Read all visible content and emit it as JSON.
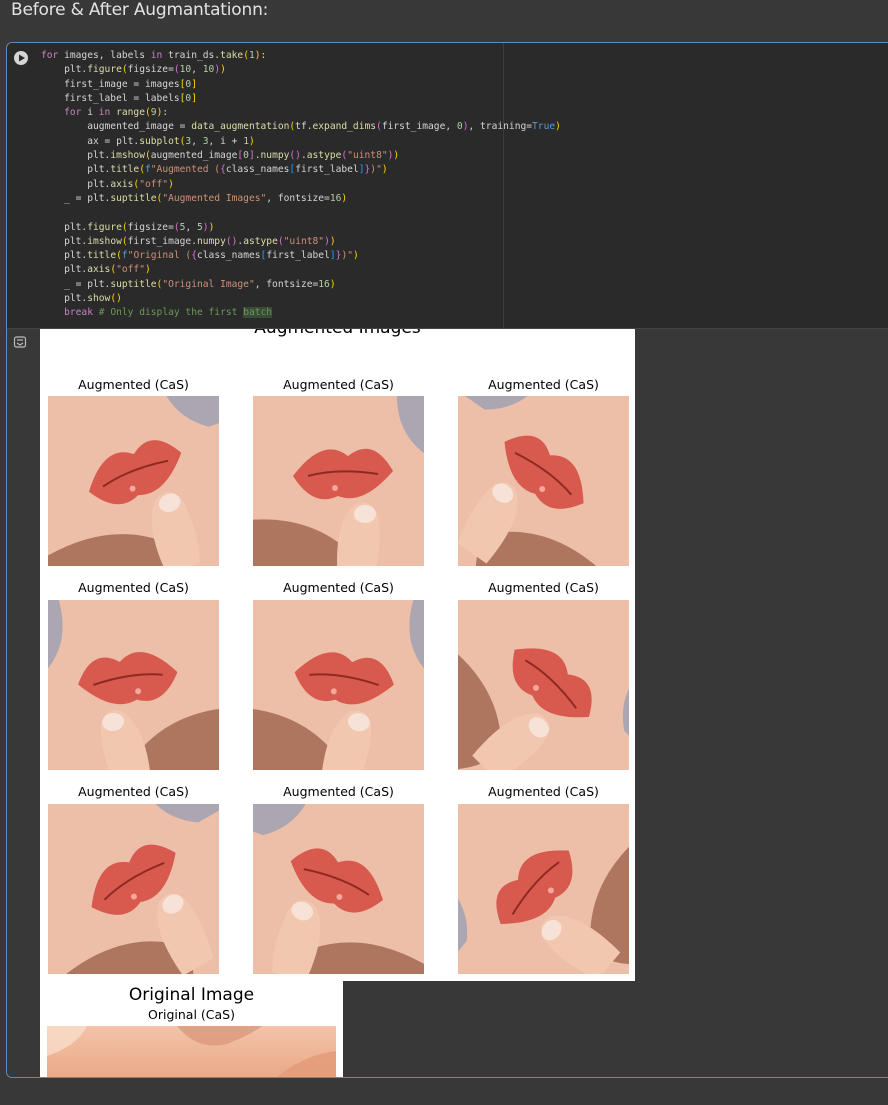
{
  "heading": "Before & After Augmantationn:",
  "code_lines": [
    "for images, labels in train_ds.take(1):",
    "    plt.figure(figsize=(10, 10))",
    "    first_image = images[0]",
    "    first_label = labels[0]",
    "    for i in range(9):",
    "        augmented_image = data_augmentation(tf.expand_dims(first_image, 0), training=True)",
    "        ax = plt.subplot(3, 3, i + 1)",
    "        plt.imshow(augmented_image[0].numpy().astype(\"uint8\"))",
    "        plt.title(f\"Augmented ({class_names[first_label]})\")",
    "        plt.axis(\"off\")",
    "    _ = plt.suptitle(\"Augmented Images\", fontsize=16)",
    "",
    "    plt.figure(figsize=(5, 5))",
    "    plt.imshow(first_image.numpy().astype(\"uint8\"))",
    "    plt.title(f\"Original ({class_names[first_label]})\")",
    "    plt.axis(\"off\")",
    "    _ = plt.suptitle(\"Original Image\", fontsize=16)",
    "    plt.show()",
    "    break # Only display the first batch"
  ],
  "figure_augmented": {
    "suptitle": "Augmented Images",
    "subplot_titles": [
      "Augmented (CaS)",
      "Augmented (CaS)",
      "Augmented (CaS)",
      "Augmented (CaS)",
      "Augmented (CaS)",
      "Augmented (CaS)",
      "Augmented (CaS)",
      "Augmented (CaS)",
      "Augmented (CaS)"
    ]
  },
  "figure_original": {
    "suptitle": "Original Image",
    "title": "Original (CaS)"
  },
  "icons": {
    "run": "play-circle-icon",
    "output": "output-toggle-icon"
  },
  "colors": {
    "page_bg": "#383838",
    "code_bg": "#2a2a2a",
    "cell_border": "#5b8dbc",
    "skin_light": "#f6d6c3",
    "skin_mid": "#e3a588",
    "lip_red": "#d85a4e",
    "shadow_dark": "#7a3a22"
  }
}
